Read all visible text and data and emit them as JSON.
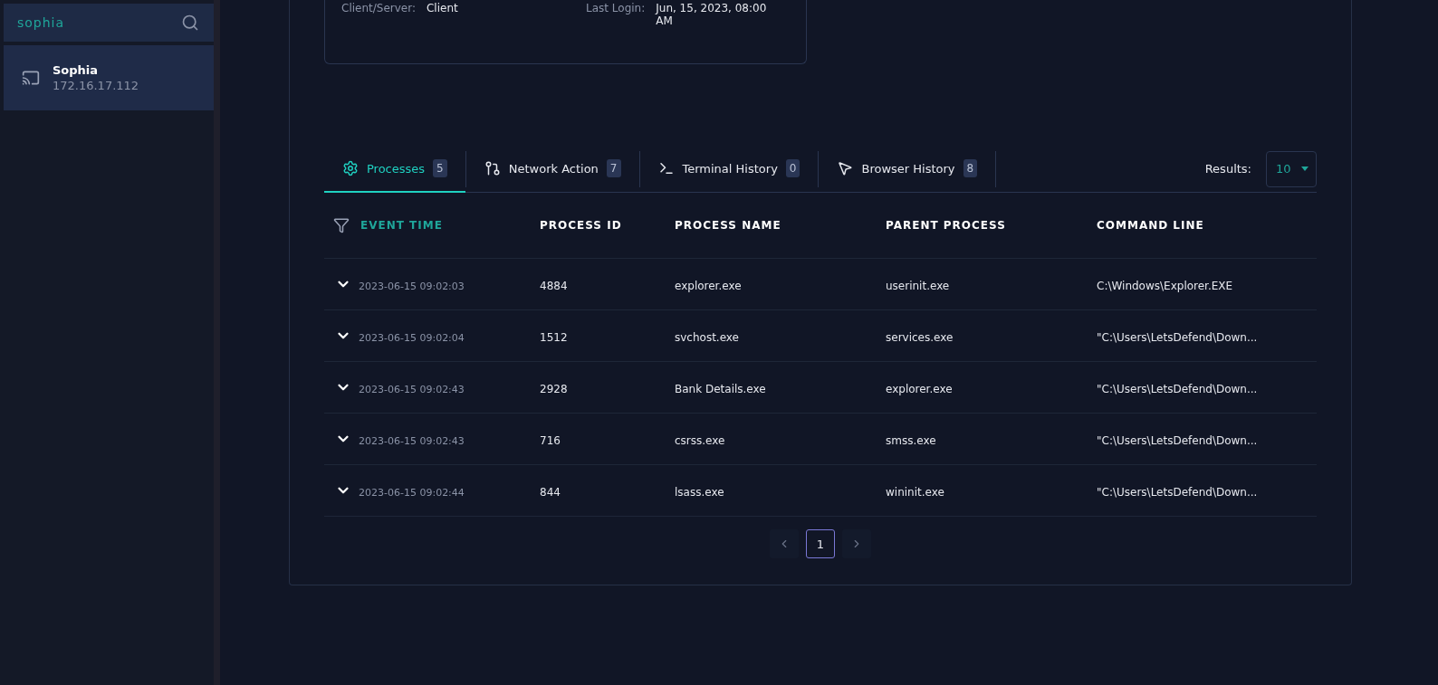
{
  "sidebar": {
    "search": {
      "value": "sophia"
    },
    "items": [
      {
        "name": "Sophia",
        "ip": "172.16.17.112",
        "selected": true
      }
    ]
  },
  "info_card": {
    "fields": [
      {
        "label": "Client/Server:",
        "value": "Client"
      },
      {
        "label": "Last Login:",
        "value": "Jun, 15, 2023, 08:00 AM"
      }
    ]
  },
  "tabs": [
    {
      "label": "Processes",
      "count": "5",
      "selected": true
    },
    {
      "label": "Network Action",
      "count": "7",
      "selected": false
    },
    {
      "label": "Terminal History",
      "count": "0",
      "selected": false
    },
    {
      "label": "Browser History",
      "count": "8",
      "selected": false
    }
  ],
  "results": {
    "label": "Results:",
    "value": "10"
  },
  "table": {
    "columns": [
      {
        "label": "EVENT TIME",
        "filter": true
      },
      {
        "label": "PROCESS ID",
        "filter": false
      },
      {
        "label": "PROCESS NAME",
        "filter": false
      },
      {
        "label": "PARENT PROCESS",
        "filter": false
      },
      {
        "label": "COMMAND LINE",
        "filter": false
      }
    ],
    "rows": [
      {
        "time": "2023-06-15 09:02:03",
        "pid": "4884",
        "name": "explorer.exe",
        "parent": "userinit.exe",
        "cmd": "C:\\Windows\\Explorer.EXE"
      },
      {
        "time": "2023-06-15 09:02:04",
        "pid": "1512",
        "name": "svchost.exe",
        "parent": "services.exe",
        "cmd": "\"C:\\Users\\LetsDefend\\Down..."
      },
      {
        "time": "2023-06-15 09:02:43",
        "pid": "2928",
        "name": "Bank Details.exe",
        "parent": "explorer.exe",
        "cmd": "\"C:\\Users\\LetsDefend\\Down..."
      },
      {
        "time": "2023-06-15 09:02:43",
        "pid": "716",
        "name": "csrss.exe",
        "parent": "smss.exe",
        "cmd": "\"C:\\Users\\LetsDefend\\Down..."
      },
      {
        "time": "2023-06-15 09:02:44",
        "pid": "844",
        "name": "lsass.exe",
        "parent": "wininit.exe",
        "cmd": "\"C:\\Users\\LetsDefend\\Down..."
      }
    ]
  },
  "pagination": {
    "pages": [
      {
        "label": "1",
        "selected": true
      }
    ]
  }
}
